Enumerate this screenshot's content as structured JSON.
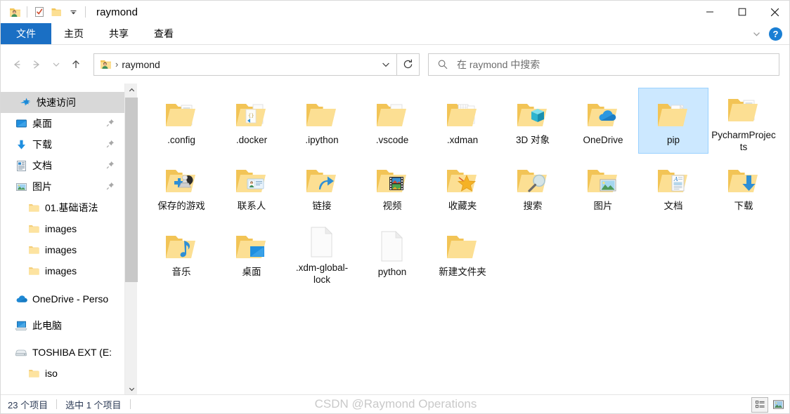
{
  "window": {
    "title": "raymond",
    "controls": {
      "minimize": "—",
      "maximize": "☐",
      "close": "✕"
    }
  },
  "quick_access_toolbar": {
    "items": [
      {
        "name": "user-folder-icon",
        "label": "raymond"
      },
      {
        "name": "properties-icon",
        "label": "属性"
      },
      {
        "name": "new-folder-icon",
        "label": "新建文件夹"
      },
      {
        "name": "customize-chevron-icon",
        "label": "自定义快速访问工具栏"
      }
    ]
  },
  "ribbon": {
    "tabs": [
      {
        "label": "文件",
        "active": true
      },
      {
        "label": "主页",
        "active": false
      },
      {
        "label": "共享",
        "active": false
      },
      {
        "label": "查看",
        "active": false
      }
    ],
    "accent_color": "#1a6fc4",
    "expand_label": "展开功能区",
    "help_label": "?"
  },
  "navigation": {
    "back": "←",
    "forward": "→",
    "recent": "⌄",
    "up": "↑",
    "refresh": "↻"
  },
  "address_bar": {
    "icon": "user-folder-icon",
    "separator": "›",
    "path_value": "raymond",
    "dropdown": "⌄"
  },
  "search": {
    "icon": "search-icon",
    "placeholder": "在 raymond 中搜索",
    "value": ""
  },
  "sidebar": {
    "items": [
      {
        "label": "快速访问",
        "icon": "quick-access-star-icon",
        "type": "header",
        "pinned": false,
        "level": 0
      },
      {
        "label": "桌面",
        "icon": "desktop-icon",
        "type": "item",
        "pinned": true,
        "level": 1
      },
      {
        "label": "下载",
        "icon": "downloads-arrow-icon",
        "type": "item",
        "pinned": true,
        "level": 1
      },
      {
        "label": "文档",
        "icon": "documents-icon",
        "type": "item",
        "pinned": true,
        "level": 1
      },
      {
        "label": "图片",
        "icon": "pictures-icon",
        "type": "item",
        "pinned": true,
        "level": 1
      },
      {
        "label": "01.基础语法",
        "icon": "folder-icon",
        "type": "item",
        "pinned": false,
        "level": 2
      },
      {
        "label": "images",
        "icon": "folder-icon",
        "type": "item",
        "pinned": false,
        "level": 2
      },
      {
        "label": "images",
        "icon": "folder-icon",
        "type": "item",
        "pinned": false,
        "level": 2
      },
      {
        "label": "images",
        "icon": "folder-icon",
        "type": "item",
        "pinned": false,
        "level": 2
      },
      {
        "label": "OneDrive - Perso",
        "icon": "onedrive-cloud-icon",
        "type": "item",
        "pinned": false,
        "level": 0
      },
      {
        "label": "此电脑",
        "icon": "this-pc-icon",
        "type": "item",
        "pinned": false,
        "level": 0
      },
      {
        "label": "TOSHIBA EXT (E:",
        "icon": "drive-icon",
        "type": "item",
        "pinned": false,
        "level": 0
      },
      {
        "label": "iso",
        "icon": "folder-icon",
        "type": "item",
        "pinned": false,
        "level": 2
      }
    ],
    "scrollbar": {
      "up": "⌃",
      "down": "⌄"
    }
  },
  "content": {
    "items": [
      {
        "name": ".config",
        "icon": "folder-config"
      },
      {
        "name": ".docker",
        "icon": "folder-docker"
      },
      {
        "name": ".ipython",
        "icon": "folder-plain"
      },
      {
        "name": ".vscode",
        "icon": "folder-vscode"
      },
      {
        "name": ".xdman",
        "icon": "folder-xdman"
      },
      {
        "name": "3D 对象",
        "icon": "folder-3dobjects"
      },
      {
        "name": "OneDrive",
        "icon": "folder-onedrive"
      },
      {
        "name": "pip",
        "icon": "folder-pip",
        "selected": true
      },
      {
        "name": "PycharmProjects",
        "icon": "folder-pycharm"
      },
      {
        "name": "保存的游戏",
        "icon": "folder-savedgames"
      },
      {
        "name": "联系人",
        "icon": "folder-contacts"
      },
      {
        "name": "链接",
        "icon": "folder-links"
      },
      {
        "name": "视频",
        "icon": "folder-videos"
      },
      {
        "name": "收藏夹",
        "icon": "folder-favorites"
      },
      {
        "name": "搜索",
        "icon": "folder-searches"
      },
      {
        "name": "图片",
        "icon": "folder-pictures"
      },
      {
        "name": "文档",
        "icon": "folder-documents"
      },
      {
        "name": "下载",
        "icon": "folder-downloads"
      },
      {
        "name": "音乐",
        "icon": "folder-music"
      },
      {
        "name": "桌面",
        "icon": "folder-desktop"
      },
      {
        "name": ".xdm-global-lock",
        "icon": "file-blank"
      },
      {
        "name": "python",
        "icon": "file-blank"
      },
      {
        "name": "新建文件夹",
        "icon": "folder-plain"
      }
    ]
  },
  "status_bar": {
    "item_count": "23 个项目",
    "selection": "选中 1 个项目",
    "watermark": "CSDN @Raymond Operations",
    "view_details_label": "详细信息",
    "view_thumbnails_label": "大图标"
  },
  "colors": {
    "accent": "#1a6fc4",
    "selection_fill": "#cce8ff",
    "selection_border": "#99d1ff",
    "folder_body": "#fbd77d",
    "folder_front": "#fde39a",
    "sidebar_header": "#d8d8d8"
  }
}
